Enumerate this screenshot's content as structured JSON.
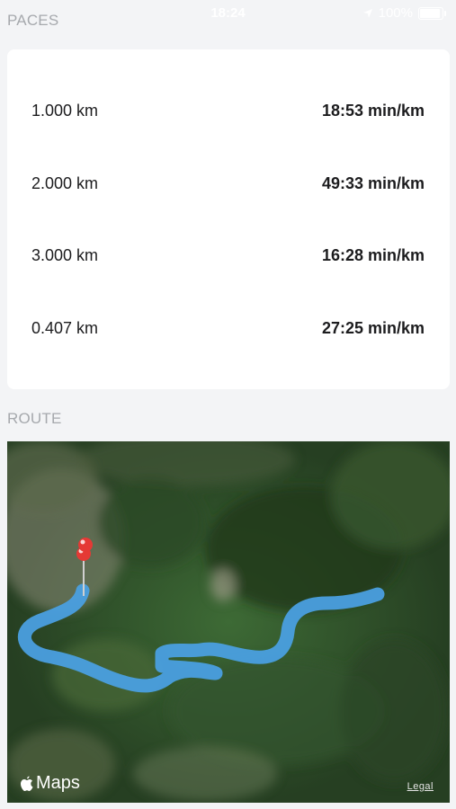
{
  "status_bar": {
    "time": "18:24",
    "battery": "100%"
  },
  "paces": {
    "header": "PACES",
    "rows": [
      {
        "distance": "1.000 km",
        "pace": "18:53 min/km"
      },
      {
        "distance": "2.000 km",
        "pace": "49:33 min/km"
      },
      {
        "distance": "3.000 km",
        "pace": "16:28 min/km"
      },
      {
        "distance": "0.407 km",
        "pace": "27:25 min/km"
      }
    ]
  },
  "route": {
    "header": "ROUTE",
    "maps_brand": "Maps",
    "legal": "Legal",
    "route_color": "#4a9fe0",
    "pin_color": "#e53935"
  }
}
